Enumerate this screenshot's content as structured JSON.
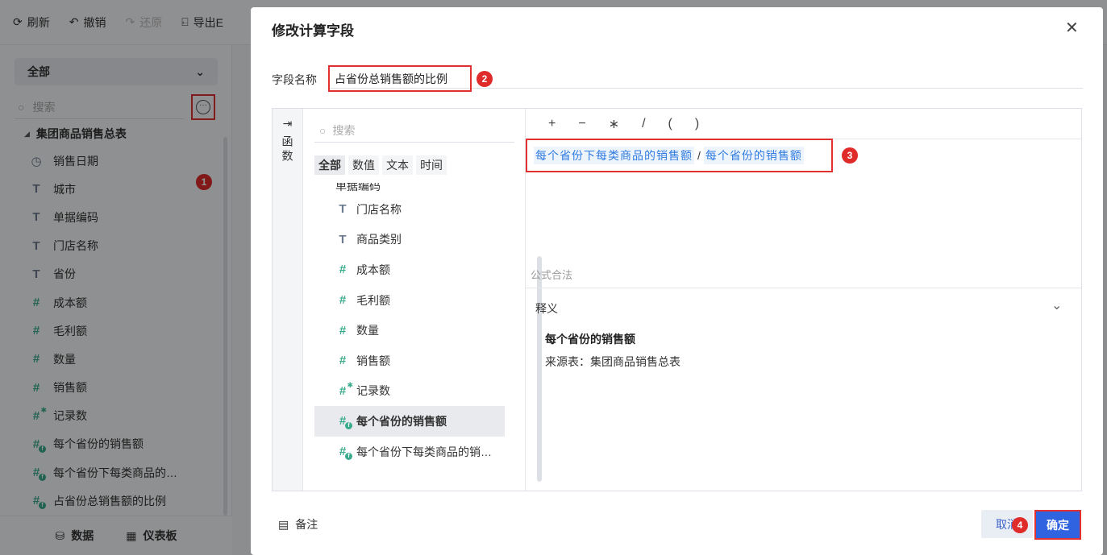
{
  "toolbar": {
    "refresh": "刷新",
    "undo": "撤销",
    "redo": "还原",
    "export": "导出E"
  },
  "sidebar": {
    "select_value": "全部",
    "search_placeholder": "搜索",
    "more_icon": "ellipsis-circle-icon",
    "table_name": "集团商品销售总表",
    "fields": [
      {
        "label": "销售日期",
        "icon": "clock-icon"
      },
      {
        "label": "城市",
        "icon": "text-type-icon"
      },
      {
        "label": "单据编码",
        "icon": "text-type-icon"
      },
      {
        "label": "门店名称",
        "icon": "text-type-icon"
      },
      {
        "label": "省份",
        "icon": "text-type-icon"
      },
      {
        "label": "成本额",
        "icon": "number-type-icon"
      },
      {
        "label": "毛利额",
        "icon": "number-type-icon"
      },
      {
        "label": "数量",
        "icon": "number-type-icon"
      },
      {
        "label": "销售额",
        "icon": "number-type-icon"
      },
      {
        "label": "记录数",
        "icon": "count-type-icon"
      },
      {
        "label": "每个省份的销售额",
        "icon": "calc-number-icon"
      },
      {
        "label": "每个省份下每类商品的…",
        "icon": "calc-number-icon"
      },
      {
        "label": "占省份总销售额的比例",
        "icon": "calc-number-icon"
      }
    ],
    "bottom": {
      "data": "数据",
      "dashboard": "仪表板"
    }
  },
  "dialog": {
    "title": "修改计算字段",
    "name_label": "字段名称",
    "name_value": "占省份总销售额的比例",
    "fn_strip_label": "函数",
    "search_placeholder": "搜索",
    "tabs": [
      "全部",
      "数值",
      "文本",
      "时间"
    ],
    "list_cut_top": "单据编码",
    "list": [
      {
        "label": "门店名称",
        "icon": "text-type-icon"
      },
      {
        "label": "商品类别",
        "icon": "text-type-icon"
      },
      {
        "label": "成本额",
        "icon": "number-type-icon"
      },
      {
        "label": "毛利额",
        "icon": "number-type-icon"
      },
      {
        "label": "数量",
        "icon": "number-type-icon"
      },
      {
        "label": "销售额",
        "icon": "number-type-icon"
      },
      {
        "label": "记录数",
        "icon": "count-type-icon"
      },
      {
        "label": "每个省份的销售额",
        "icon": "calc-number-icon"
      },
      {
        "label": "每个省份下每类商品的销…",
        "icon": "calc-number-icon"
      }
    ],
    "selected_index": 7,
    "operators": [
      "+",
      "−",
      "∗",
      "/",
      "(",
      ")"
    ],
    "formula": {
      "token1": "每个省份下每类商品的销售额",
      "op": "/",
      "token2": "每个省份的销售额"
    },
    "validity": "公式合法",
    "desc_label": "释义",
    "desc_title": "每个省份的销售额",
    "desc_source": "来源表：集团商品销售总表",
    "note": "备注",
    "cancel": "取消",
    "ok": "确定"
  },
  "annotations": [
    "1",
    "2",
    "3",
    "4"
  ],
  "colors": {
    "accent": "#2f63e0",
    "highlight": "#e03030",
    "token": "#2f7be0",
    "number_icon": "#3aab8c"
  }
}
